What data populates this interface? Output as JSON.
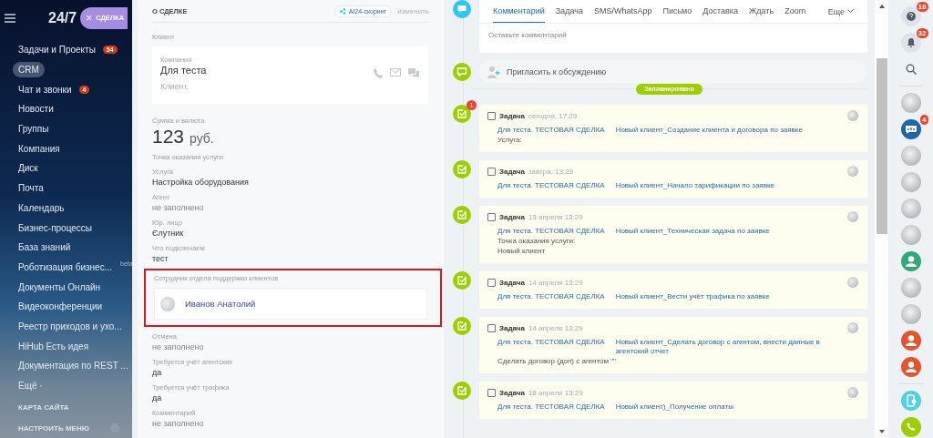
{
  "sidebar": {
    "logo": "24/7",
    "deal_button": {
      "icon": "×",
      "label": "СДЕЛКА"
    },
    "items": [
      {
        "label": "Задачи и Проекты",
        "counter": "54",
        "selected": false
      },
      {
        "label": "CRM",
        "selected": true
      },
      {
        "label": "Чат и звонки",
        "counter": "4",
        "selected": false
      },
      {
        "label": "Новости",
        "selected": false
      },
      {
        "label": "Группы",
        "selected": false
      },
      {
        "label": "Компания",
        "selected": false
      },
      {
        "label": "Диск",
        "selected": false
      },
      {
        "label": "Почта",
        "selected": false
      },
      {
        "label": "Календарь",
        "selected": false
      },
      {
        "label": "Бизнес-процессы",
        "selected": false
      },
      {
        "label": "База знаний",
        "selected": false
      },
      {
        "label": "Роботизация бизнес...",
        "tag": "beta",
        "selected": false
      },
      {
        "label": "Документы Онлайн",
        "selected": false
      },
      {
        "label": "Видеоконференции",
        "selected": false
      },
      {
        "label": "Реестр приходов и ухо...",
        "selected": false
      },
      {
        "label": "HiHub Есть идея",
        "selected": false
      },
      {
        "label": "Документация по REST ...",
        "selected": false
      },
      {
        "label": "Ещё ·",
        "selected": false
      }
    ],
    "footer": [
      "КАРТА САЙТА",
      "НАСТРОИТЬ МЕНЮ"
    ]
  },
  "deal": {
    "title": "О СДЕЛКЕ",
    "scoring": "AI24-скоринг",
    "edit": "изменить",
    "client": {
      "label": "Клиент",
      "type": "Компания",
      "name": "Для теста",
      "role": "Клиент,"
    },
    "sum": {
      "label": "Сумма и валюта",
      "amount": "123",
      "currency": "руб."
    },
    "fields": [
      {
        "label": "Точка оказания услуги"
      },
      {
        "label": "Услуга",
        "value": "Настройка оборудования",
        "empty": false
      },
      {
        "label": "Агент",
        "value": "не заполнено",
        "empty": true
      },
      {
        "label": "Юр. лицо",
        "value": "Єлутник",
        "empty": false
      },
      {
        "label": "Что подключаем",
        "value": "тест",
        "empty": false
      }
    ],
    "employee": {
      "label": "Сотрудник отдела поддержки клиентов",
      "name": "Иванов Анатолий",
      "highlighted": true
    },
    "fields_after": [
      {
        "label": "Отмена",
        "value": "не заполнено",
        "empty": true
      },
      {
        "label": "Требуется учёт агентских",
        "value": "да",
        "empty": false
      },
      {
        "label": "Требуется учёт трафика",
        "value": "да",
        "empty": false
      },
      {
        "label": "Комментарий",
        "value": "не заполнено",
        "empty": true
      }
    ]
  },
  "timeline": {
    "tabs": [
      {
        "label": "Комментарий",
        "selected": true
      },
      {
        "label": "Задача",
        "selected": false
      },
      {
        "label": "SMS/WhatsApp",
        "selected": false
      },
      {
        "label": "Письмо",
        "selected": false
      },
      {
        "label": "Доставка",
        "selected": false
      },
      {
        "label": "Ждать",
        "selected": false
      },
      {
        "label": "Zoom",
        "selected": false
      }
    ],
    "more": "Еще",
    "comment_placeholder": "Оставьте комментарий",
    "invite": "Пригласить к обсуждению",
    "section": "Запланировано",
    "tasks": [
      {
        "title": "Задача",
        "date": "сегодня, 17:29",
        "checked": false,
        "counter": "1",
        "deal": "Для теста. ТЕСТОВАЯ СДЕЛКА",
        "subject": "Новый клиент_Создание клиента и договора по заявке",
        "notes": [
          "Услуга:"
        ]
      },
      {
        "title": "Задача",
        "date": "завтра, 13:29",
        "checked": false,
        "deal": "Для теста. ТЕСТОВАЯ СДЕЛКА",
        "subject": "Новый клиент_Начало тарификации по заявке"
      },
      {
        "title": "Задача",
        "date": "13 апреля 13:29",
        "checked": false,
        "deal": "Для теста. ТЕСТОВАЯ СДЕЛКА",
        "subject": "Новый клиент_Техническая задача по заявке",
        "notes": [
          "Точка оказания услуги:",
          "Новый клиент"
        ]
      },
      {
        "title": "Задача",
        "date": "14 апреля 13:29",
        "checked": false,
        "deal": "Для теста. ТЕСТОВАЯ СДЕЛКА",
        "subject": "Новый клиент_Вести учёт трафика по заявке"
      },
      {
        "title": "Задача",
        "date": "14 апреля 13:29",
        "checked": false,
        "deal": "Для теста. ТЕСТОВАЯ СДЕЛКА",
        "subject": "Новый клиент_Сделать договор с агентом, внести данные в агентский отчет",
        "notes": [
          "Сделать договор (доп) с агентом \"\""
        ]
      },
      {
        "title": "Задача",
        "date": "18 апреля 13:29",
        "checked": false,
        "deal": "Для теста. ТЕСТОВАЯ СДЕЛКА",
        "subject": "Новый клиент)_Получение оплаты"
      }
    ]
  },
  "right_bar": {
    "top": [
      {
        "kind": "help",
        "counter": "18"
      },
      {
        "kind": "bell",
        "counter": "32"
      },
      {
        "kind": "search"
      }
    ],
    "contacts": [
      {
        "kind": "photo"
      },
      {
        "kind": "group-chat",
        "counter": "4",
        "color": "#1f64ae"
      },
      {
        "kind": "photo"
      },
      {
        "kind": "photo"
      },
      {
        "kind": "photo"
      },
      {
        "kind": "photo"
      },
      {
        "kind": "user",
        "color": "#35a57a"
      },
      {
        "kind": "photo"
      },
      {
        "kind": "photo"
      },
      {
        "kind": "user",
        "color": "#e5532d"
      },
      {
        "kind": "user",
        "color": "#e5532d"
      }
    ],
    "bottom": [
      {
        "kind": "device"
      },
      {
        "kind": "call"
      }
    ]
  }
}
